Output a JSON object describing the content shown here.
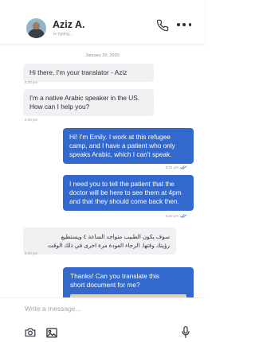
{
  "contact": {
    "name": "Aziz A.",
    "status": "is typing..."
  },
  "header": {
    "call_icon": "phone-icon",
    "menu_icon": "more-options-icon"
  },
  "conversation": {
    "date": "January 20, 2020",
    "messages": [
      {
        "direction": "in",
        "lines": [
          "Hi there, I'm your translator - Aziz"
        ],
        "time": "6:30 pm"
      },
      {
        "direction": "in",
        "lines": [
          "I'm a native Arabic speaker in the US.",
          "How can I help you?"
        ],
        "time": "6:30 pm"
      },
      {
        "direction": "out",
        "lines": [
          "Hi! I'm Emily. I work at this refugee",
          "camp, and I have a patient who only",
          "speaks Arabic, which I can't speak."
        ],
        "time": "6:31 pm",
        "read": true
      },
      {
        "direction": "out",
        "lines": [
          "I need you to tell the patient that the",
          "doctor will be here to see them at 4pm",
          "and that they should come back then."
        ],
        "time": "6:32 pm",
        "read": true
      },
      {
        "direction": "in",
        "lines": [
          "سوف يكون الطبيب متواجد الساعة ٤ ويستطيع",
          "رؤيتك وقتها. الرجاء العودة مرة اخرى في ذلك الوقت"
        ],
        "time": "6:30 pm"
      },
      {
        "direction": "out",
        "lines": [
          "Thanks!  Can you translate this",
          "short document for me?"
        ]
      }
    ]
  },
  "composer": {
    "placeholder": "Write a message...",
    "value": "",
    "camera_icon": "camera-icon",
    "gallery_icon": "gallery-icon",
    "mic_icon": "microphone-icon"
  },
  "colors": {
    "accent": "#3369cc",
    "incoming_bubble": "#f0f1f3",
    "read_check": "#3369cc"
  }
}
